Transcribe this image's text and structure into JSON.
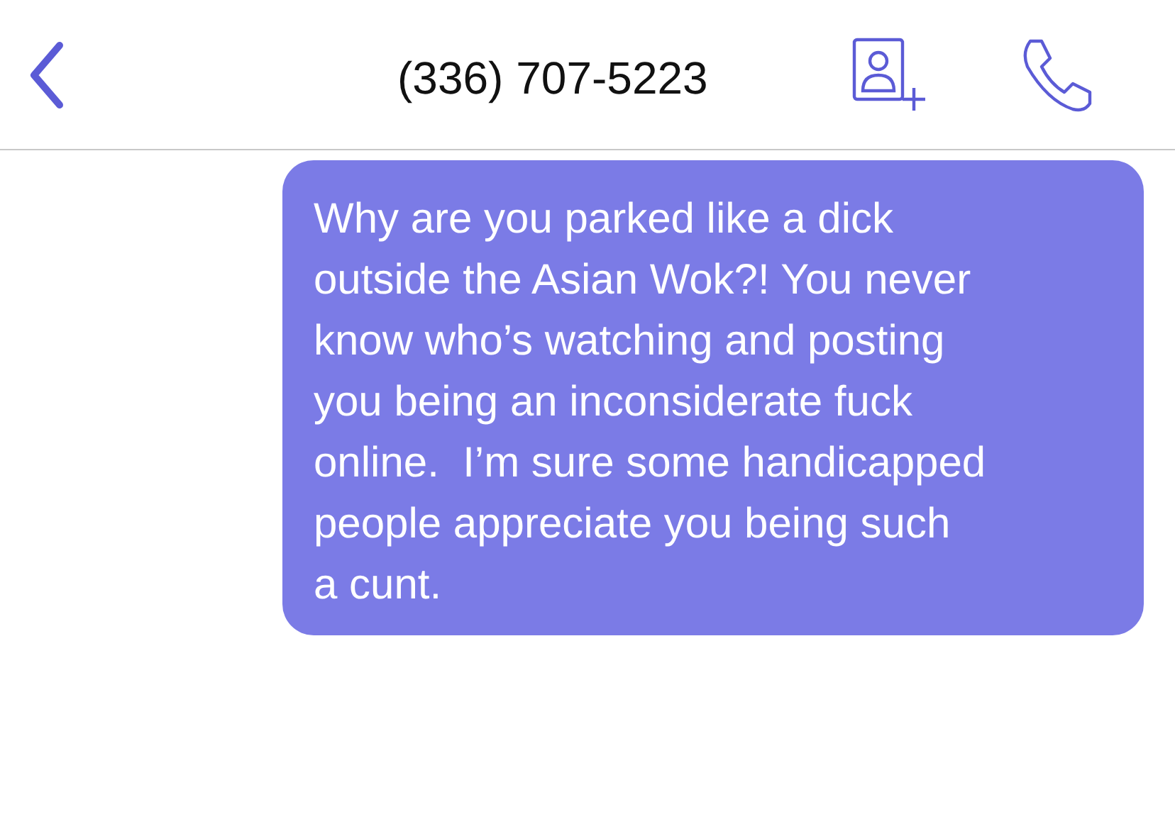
{
  "header": {
    "title": "(336) 707-5223"
  },
  "messages": [
    {
      "kind": "outgoing",
      "lines": [
        "Why are you parked like a dick",
        "outside the Asian Wok?! You never",
        "know who’s watching and posting",
        "you being an inconsiderate fuck",
        "online.  I’m sure some handicapped",
        "people appreciate you being such",
        "a cunt."
      ]
    }
  ]
}
